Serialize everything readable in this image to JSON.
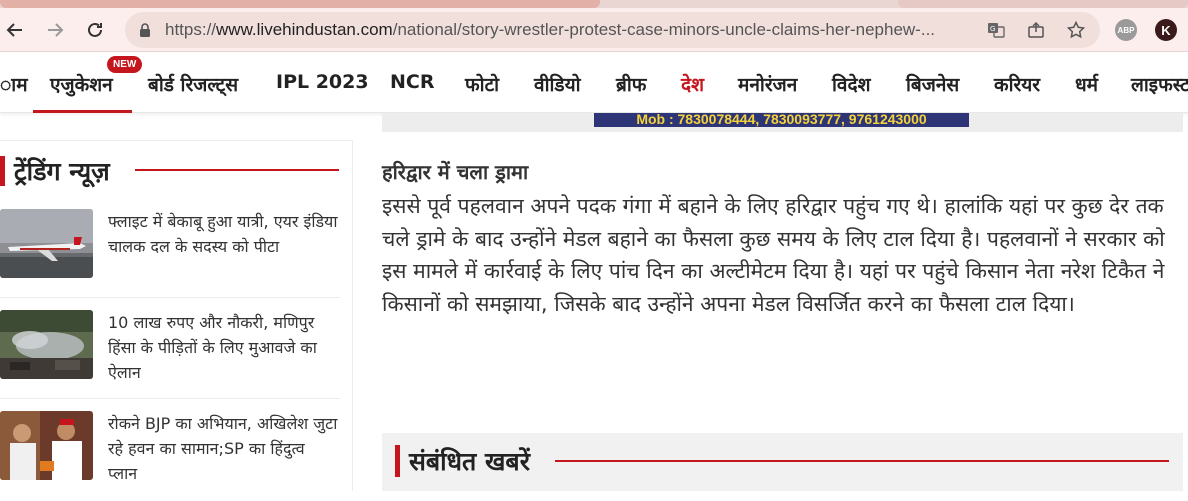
{
  "browser": {
    "url_scheme": "https://",
    "url_host": "www.livehindustan.com",
    "url_path": "/national/story-wrestler-protest-case-minors-uncle-claims-her-nephew-...",
    "ext_abp": "ABP",
    "profile_initial": "K",
    "icons": [
      "back-arrow-icon",
      "forward-arrow-icon",
      "reload-icon",
      "lock-icon",
      "translate-icon",
      "share-icon",
      "bookmark-star-icon"
    ]
  },
  "nav": {
    "items": [
      {
        "label": "ाम"
      },
      {
        "label": "एजुकेशन",
        "badge": "NEW"
      },
      {
        "label": "बोर्ड रिजल्ट्स"
      },
      {
        "label": "IPL 2023"
      },
      {
        "label": "NCR"
      },
      {
        "label": "फोटो"
      },
      {
        "label": "वीडियो"
      },
      {
        "label": "ब्रीफ"
      },
      {
        "label": "देश"
      },
      {
        "label": "मनोरंजन"
      },
      {
        "label": "विदेश"
      },
      {
        "label": "बिजनेस"
      },
      {
        "label": "करियर"
      },
      {
        "label": "धर्म"
      },
      {
        "label": "लाइफस्ट"
      }
    ],
    "accent_color": "#c4161c"
  },
  "ad": {
    "text": "Mob : 7830078444, 7830093777, 9761243000"
  },
  "sidebar": {
    "title": "ट्रेंडिंग न्यूज़",
    "items": [
      {
        "headline": "फ्लाइट में बेकाबू हुआ यात्री, एयर इंडिया चालक दल के सदस्य को पीटा"
      },
      {
        "headline": "10 लाख रुपए और नौकरी, मणिपुर हिंसा के पीड़ितों के लिए मुआवजे का ऐलान"
      },
      {
        "headline": "रोकने BJP का अभियान, अखिलेश जुटा रहे हवन का सामान;SP का हिंदुत्व प्लान"
      }
    ]
  },
  "article": {
    "subheading": "हरिद्वार में चला ड्रामा",
    "body": "इससे पूर्व पहलवान अपने पदक गंगा में बहाने के लिए हरिद्वार पहुंच गए थे। हालांकि यहां पर कुछ देर तक चले ड्रामे के बाद उन्होंने मेडल बहाने का फैसला कुछ समय के लिए टाल दिया है। पहलवानों ने सरकार को इस मामले में कार्रवाई के लिए पांच दिन का अल्टीमेटम दिया है। यहां पर पहुंचे किसान नेता नरेश टिकैत ने किसानों को समझाया, जिसके बाद उन्होंने अपना मेडल विसर्जित करने का फैसला टाल दिया।"
  },
  "related": {
    "title": "संबंधित खबरें"
  }
}
